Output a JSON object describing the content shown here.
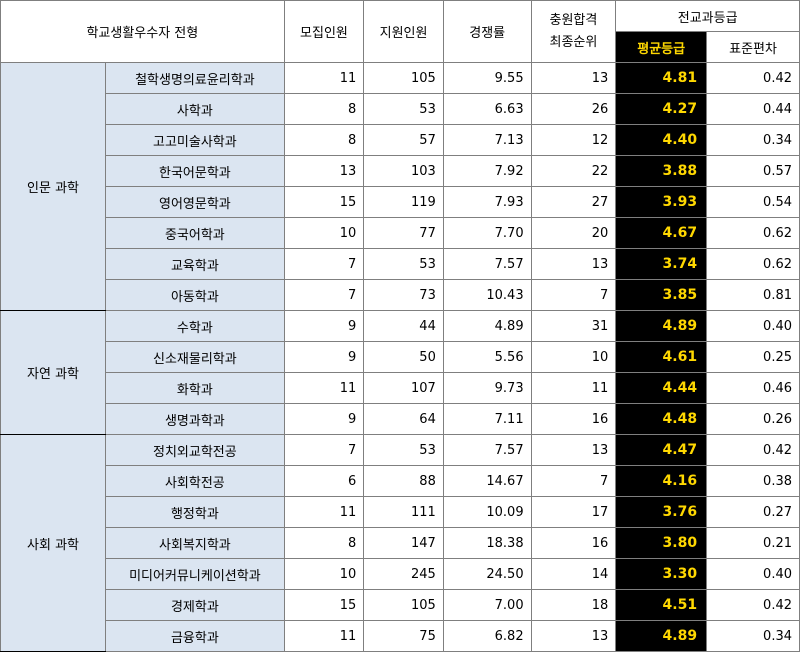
{
  "header": {
    "track": "학교생활우수자 전형",
    "recruit": "모집인원",
    "applicants": "지원인원",
    "competition": "경쟁률",
    "rank_line1": "충원합격",
    "rank_line2": "최종순위",
    "grade_group": "전교과등급",
    "avg": "평균등급",
    "std": "표준편차"
  },
  "groups": [
    {
      "name": "인문 과학",
      "rows": [
        {
          "dept": "철학생명의료윤리학과",
          "recruit": "11",
          "applicants": "105",
          "competition": "9.55",
          "rank": "13",
          "avg": "4.81",
          "std": "0.42"
        },
        {
          "dept": "사학과",
          "recruit": "8",
          "applicants": "53",
          "competition": "6.63",
          "rank": "26",
          "avg": "4.27",
          "std": "0.44"
        },
        {
          "dept": "고고미술사학과",
          "recruit": "8",
          "applicants": "57",
          "competition": "7.13",
          "rank": "12",
          "avg": "4.40",
          "std": "0.34"
        },
        {
          "dept": "한국어문학과",
          "recruit": "13",
          "applicants": "103",
          "competition": "7.92",
          "rank": "22",
          "avg": "3.88",
          "std": "0.57"
        },
        {
          "dept": "영어영문학과",
          "recruit": "15",
          "applicants": "119",
          "competition": "7.93",
          "rank": "27",
          "avg": "3.93",
          "std": "0.54"
        },
        {
          "dept": "중국어학과",
          "recruit": "10",
          "applicants": "77",
          "competition": "7.70",
          "rank": "20",
          "avg": "4.67",
          "std": "0.62"
        },
        {
          "dept": "교육학과",
          "recruit": "7",
          "applicants": "53",
          "competition": "7.57",
          "rank": "13",
          "avg": "3.74",
          "std": "0.62"
        },
        {
          "dept": "아동학과",
          "recruit": "7",
          "applicants": "73",
          "competition": "10.43",
          "rank": "7",
          "avg": "3.85",
          "std": "0.81"
        }
      ]
    },
    {
      "name": "자연 과학",
      "rows": [
        {
          "dept": "수학과",
          "recruit": "9",
          "applicants": "44",
          "competition": "4.89",
          "rank": "31",
          "avg": "4.89",
          "std": "0.40"
        },
        {
          "dept": "신소재물리학과",
          "recruit": "9",
          "applicants": "50",
          "competition": "5.56",
          "rank": "10",
          "avg": "4.61",
          "std": "0.25"
        },
        {
          "dept": "화학과",
          "recruit": "11",
          "applicants": "107",
          "competition": "9.73",
          "rank": "11",
          "avg": "4.44",
          "std": "0.46"
        },
        {
          "dept": "생명과학과",
          "recruit": "9",
          "applicants": "64",
          "competition": "7.11",
          "rank": "16",
          "avg": "4.48",
          "std": "0.26"
        }
      ]
    },
    {
      "name": "사회 과학",
      "rows": [
        {
          "dept": "정치외교학전공",
          "recruit": "7",
          "applicants": "53",
          "competition": "7.57",
          "rank": "13",
          "avg": "4.47",
          "std": "0.42"
        },
        {
          "dept": "사회학전공",
          "recruit": "6",
          "applicants": "88",
          "competition": "14.67",
          "rank": "7",
          "avg": "4.16",
          "std": "0.38"
        },
        {
          "dept": "행정학과",
          "recruit": "11",
          "applicants": "111",
          "competition": "10.09",
          "rank": "17",
          "avg": "3.76",
          "std": "0.27"
        },
        {
          "dept": "사회복지학과",
          "recruit": "8",
          "applicants": "147",
          "competition": "18.38",
          "rank": "16",
          "avg": "3.80",
          "std": "0.21"
        },
        {
          "dept": "미디어커뮤니케이션학과",
          "recruit": "10",
          "applicants": "245",
          "competition": "24.50",
          "rank": "14",
          "avg": "3.30",
          "std": "0.40"
        },
        {
          "dept": "경제학과",
          "recruit": "15",
          "applicants": "105",
          "competition": "7.00",
          "rank": "18",
          "avg": "4.51",
          "std": "0.42"
        },
        {
          "dept": "금융학과",
          "recruit": "11",
          "applicants": "75",
          "competition": "6.82",
          "rank": "13",
          "avg": "4.89",
          "std": "0.34"
        }
      ]
    }
  ],
  "colors": {
    "dept_bg": "#dbe5f1",
    "avg_bg": "#000000",
    "avg_text": "#ffd800"
  }
}
